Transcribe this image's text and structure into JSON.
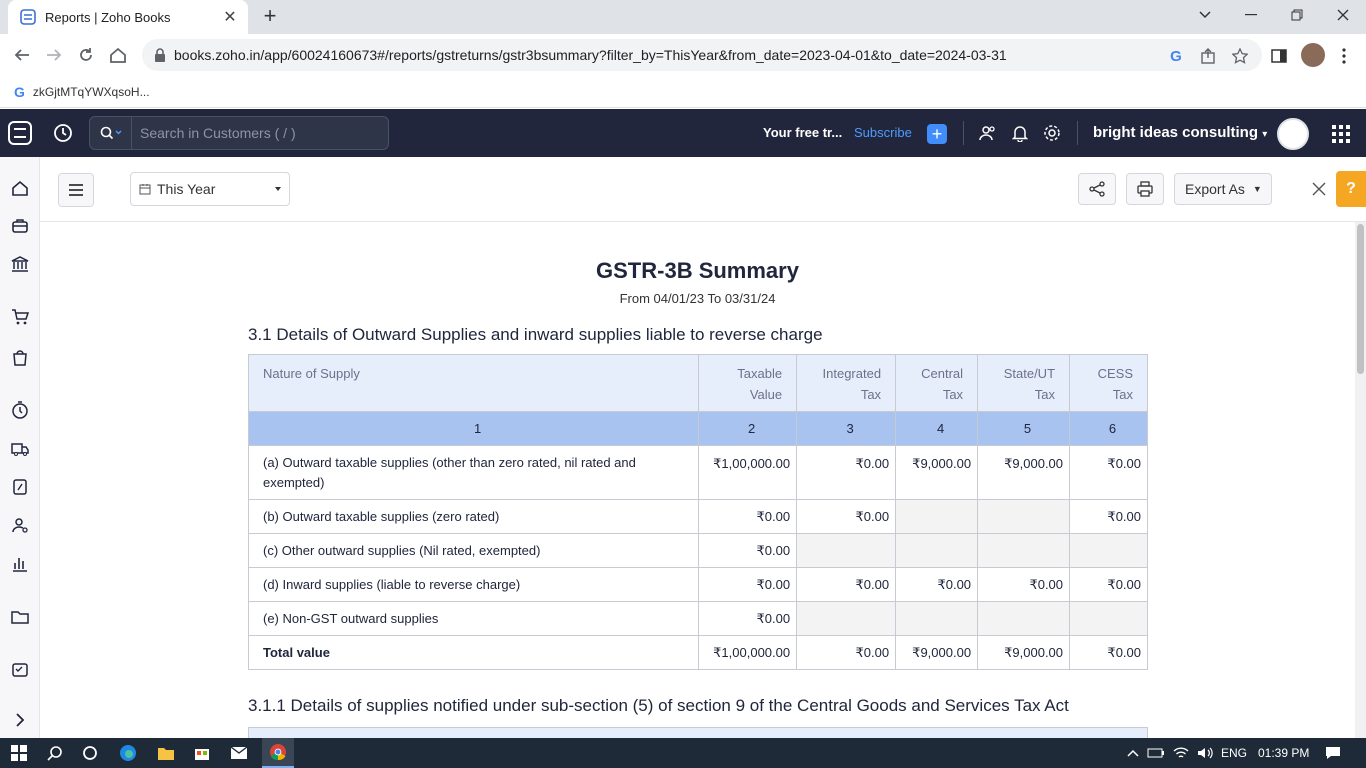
{
  "browser": {
    "tab_title": "Reports | Zoho Books",
    "url": "books.zoho.in/app/60024160673#/reports/gstreturns/gstr3bsummary?filter_by=ThisYear&from_date=2023-04-01&to_date=2024-03-31",
    "bookmark": "zkGjtMTqYWXqsoH..."
  },
  "topbar": {
    "search_placeholder": "Search in Customers ( / )",
    "trial_text": "Your free tr...",
    "subscribe": "Subscribe",
    "org_name": "bright ideas consulting"
  },
  "subheader": {
    "period": "This Year",
    "export": "Export As"
  },
  "report": {
    "title": "GSTR-3B Summary",
    "subtitle": "From 04/01/23  To 03/31/24",
    "section_31": "3.1 Details of Outward Supplies and inward supplies liable to reverse charge",
    "section_311": "3.1.1 Details of supplies notified under sub-section (5) of section 9 of the Central Goods and Services Tax Act",
    "columns": {
      "nature": "Nature of Supply",
      "taxable_1": "Taxable",
      "taxable_2": "Value",
      "igst_1": "Integrated",
      "igst_2": "Tax",
      "cgst_1": "Central",
      "cgst_2": "Tax",
      "sgst_1": "State/UT",
      "sgst_2": "Tax",
      "cess_1": "CESS",
      "cess_2": "Tax"
    },
    "index_row": [
      "1",
      "2",
      "3",
      "4",
      "5",
      "6"
    ],
    "rows": [
      {
        "nature": "(a) Outward taxable supplies (other than zero rated, nil rated and exempted)",
        "taxable": "₹1,00,000.00",
        "igst": "₹0.00",
        "cgst": "₹9,000.00",
        "sgst": "₹9,000.00",
        "cess": "₹0.00"
      },
      {
        "nature": "(b) Outward taxable supplies (zero rated)",
        "taxable": "₹0.00",
        "igst": "₹0.00",
        "cgst": "",
        "sgst": "",
        "cess": "₹0.00"
      },
      {
        "nature": "(c) Other outward supplies (Nil rated, exempted)",
        "taxable": "₹0.00",
        "igst": "",
        "cgst": "",
        "sgst": "",
        "cess": ""
      },
      {
        "nature": "(d) Inward supplies (liable to reverse charge)",
        "taxable": "₹0.00",
        "igst": "₹0.00",
        "cgst": "₹0.00",
        "sgst": "₹0.00",
        "cess": "₹0.00"
      },
      {
        "nature": "(e) Non-GST outward supplies",
        "taxable": "₹0.00",
        "igst": "",
        "cgst": "",
        "sgst": "",
        "cess": ""
      }
    ],
    "total": {
      "nature": "Total value",
      "taxable": "₹1,00,000.00",
      "igst": "₹0.00",
      "cgst": "₹9,000.00",
      "sgst": "₹9,000.00",
      "cess": "₹0.00"
    }
  },
  "taskbar": {
    "lang": "ENG",
    "time": "01:39 PM"
  },
  "colors": {
    "topbar_bg": "#21263c",
    "header_row_bg": "#e7eefb",
    "index_row_bg": "#a9c3f0",
    "accent": "#408dfb",
    "help": "#f5a623"
  }
}
